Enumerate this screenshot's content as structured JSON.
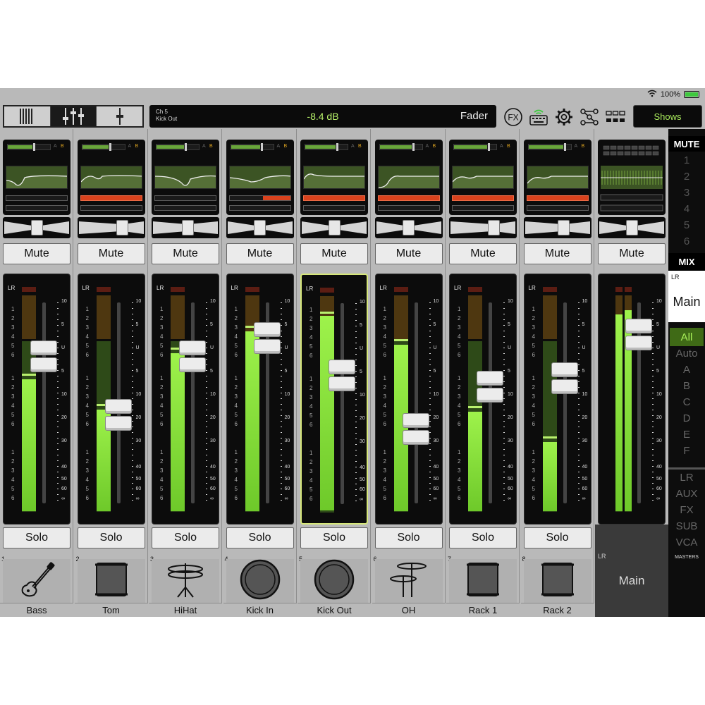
{
  "status": {
    "battery": "100%"
  },
  "channel_display": {
    "line1": "Ch 5",
    "line2": "Kick Out",
    "value": "-8.4 dB",
    "mode": "Fader"
  },
  "toolbar": {
    "fx_label": "FX",
    "shows_label": "Shows"
  },
  "labels": {
    "mute": "Mute",
    "solo": "Solo",
    "lr": "LR"
  },
  "meter_scale_left": [
    "1",
    "2",
    "3",
    "4",
    "5",
    "6",
    "1",
    "2",
    "3",
    "4",
    "5",
    "6",
    "1",
    "2",
    "3",
    "4",
    "5",
    "6"
  ],
  "fader_scale": [
    "10",
    "5",
    "U",
    "5",
    "10",
    "20",
    "30",
    "40",
    "50",
    "60",
    "∞"
  ],
  "channels": [
    {
      "num": "1",
      "name": "Bass",
      "icon": "bass-guitar-icon",
      "fader": 0.73,
      "level": 0.61,
      "pan": 0.5,
      "dyn": "off",
      "selected": false
    },
    {
      "num": "2",
      "name": "Tom",
      "icon": "tom-drum-icon",
      "fader": 0.44,
      "level": 0.47,
      "pan": 0.72,
      "dyn": "red",
      "selected": false
    },
    {
      "num": "3",
      "name": "HiHat",
      "icon": "hihat-icon",
      "fader": 0.73,
      "level": 0.73,
      "pan": 0.55,
      "dyn": "off",
      "selected": false
    },
    {
      "num": "4",
      "name": "Kick In",
      "icon": "kick-drum-icon",
      "fader": 0.82,
      "level": 0.83,
      "pan": 0.5,
      "dyn": "partial",
      "selected": false
    },
    {
      "num": "5",
      "name": "Kick Out",
      "icon": "kick-drum-icon",
      "fader": 0.64,
      "level": 0.9,
      "pan": 0.5,
      "dyn": "red",
      "selected": true
    },
    {
      "num": "6",
      "name": "OH",
      "icon": "cymbals-icon",
      "fader": 0.37,
      "level": 0.77,
      "pan": 0.5,
      "dyn": "red",
      "selected": false
    },
    {
      "num": "7",
      "name": "Rack 1",
      "icon": "rack-tom-icon",
      "fader": 0.58,
      "level": 0.46,
      "pan": 0.72,
      "dyn": "red",
      "selected": false
    },
    {
      "num": "8",
      "name": "Rack 2",
      "icon": "rack-tom-icon",
      "fader": 0.62,
      "level": 0.32,
      "pan": 0.62,
      "dyn": "red",
      "selected": false
    }
  ],
  "main_strip": {
    "label": "Main",
    "lr": "LR",
    "fader": 0.84,
    "level": 0.93
  },
  "right_panel": {
    "mute": "MUTE",
    "mute_groups": [
      "1",
      "2",
      "3",
      "4",
      "5",
      "6"
    ],
    "mix": "MIX",
    "mix_lr": "LR",
    "mix_name": "Main",
    "views": [
      "All",
      "Auto",
      "A",
      "B",
      "C",
      "D",
      "E",
      "F"
    ],
    "masters": [
      "LR",
      "AUX",
      "FX",
      "SUB",
      "VCA"
    ],
    "masters_label": "MASTERS"
  },
  "colors": {
    "meter_green": "#9ef24b",
    "dyn_red": "#d9421d",
    "selected": "#d6e77a",
    "shows_text": "#a9ea5c"
  }
}
